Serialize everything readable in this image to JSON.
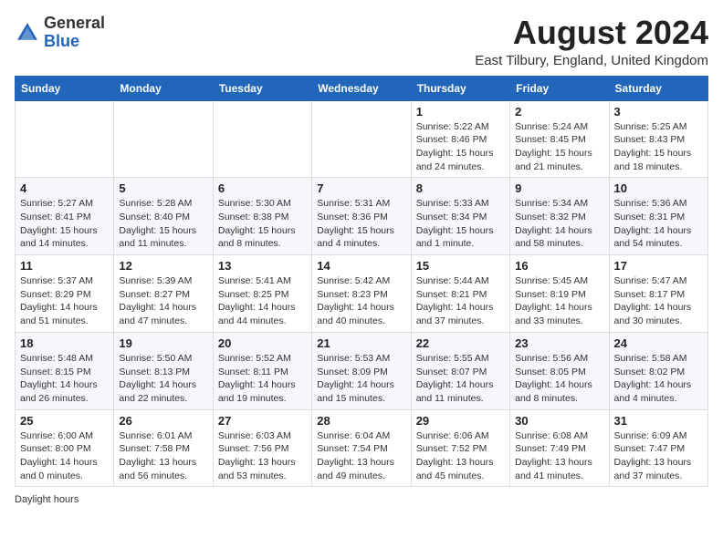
{
  "header": {
    "logo": {
      "line1": "General",
      "line2": "Blue"
    },
    "month_title": "August 2024",
    "location": "East Tilbury, England, United Kingdom"
  },
  "days_of_week": [
    "Sunday",
    "Monday",
    "Tuesday",
    "Wednesday",
    "Thursday",
    "Friday",
    "Saturday"
  ],
  "weeks": [
    [
      {
        "day": "",
        "info": ""
      },
      {
        "day": "",
        "info": ""
      },
      {
        "day": "",
        "info": ""
      },
      {
        "day": "",
        "info": ""
      },
      {
        "day": "1",
        "info": "Sunrise: 5:22 AM\nSunset: 8:46 PM\nDaylight: 15 hours\nand 24 minutes."
      },
      {
        "day": "2",
        "info": "Sunrise: 5:24 AM\nSunset: 8:45 PM\nDaylight: 15 hours\nand 21 minutes."
      },
      {
        "day": "3",
        "info": "Sunrise: 5:25 AM\nSunset: 8:43 PM\nDaylight: 15 hours\nand 18 minutes."
      }
    ],
    [
      {
        "day": "4",
        "info": "Sunrise: 5:27 AM\nSunset: 8:41 PM\nDaylight: 15 hours\nand 14 minutes."
      },
      {
        "day": "5",
        "info": "Sunrise: 5:28 AM\nSunset: 8:40 PM\nDaylight: 15 hours\nand 11 minutes."
      },
      {
        "day": "6",
        "info": "Sunrise: 5:30 AM\nSunset: 8:38 PM\nDaylight: 15 hours\nand 8 minutes."
      },
      {
        "day": "7",
        "info": "Sunrise: 5:31 AM\nSunset: 8:36 PM\nDaylight: 15 hours\nand 4 minutes."
      },
      {
        "day": "8",
        "info": "Sunrise: 5:33 AM\nSunset: 8:34 PM\nDaylight: 15 hours\nand 1 minute."
      },
      {
        "day": "9",
        "info": "Sunrise: 5:34 AM\nSunset: 8:32 PM\nDaylight: 14 hours\nand 58 minutes."
      },
      {
        "day": "10",
        "info": "Sunrise: 5:36 AM\nSunset: 8:31 PM\nDaylight: 14 hours\nand 54 minutes."
      }
    ],
    [
      {
        "day": "11",
        "info": "Sunrise: 5:37 AM\nSunset: 8:29 PM\nDaylight: 14 hours\nand 51 minutes."
      },
      {
        "day": "12",
        "info": "Sunrise: 5:39 AM\nSunset: 8:27 PM\nDaylight: 14 hours\nand 47 minutes."
      },
      {
        "day": "13",
        "info": "Sunrise: 5:41 AM\nSunset: 8:25 PM\nDaylight: 14 hours\nand 44 minutes."
      },
      {
        "day": "14",
        "info": "Sunrise: 5:42 AM\nSunset: 8:23 PM\nDaylight: 14 hours\nand 40 minutes."
      },
      {
        "day": "15",
        "info": "Sunrise: 5:44 AM\nSunset: 8:21 PM\nDaylight: 14 hours\nand 37 minutes."
      },
      {
        "day": "16",
        "info": "Sunrise: 5:45 AM\nSunset: 8:19 PM\nDaylight: 14 hours\nand 33 minutes."
      },
      {
        "day": "17",
        "info": "Sunrise: 5:47 AM\nSunset: 8:17 PM\nDaylight: 14 hours\nand 30 minutes."
      }
    ],
    [
      {
        "day": "18",
        "info": "Sunrise: 5:48 AM\nSunset: 8:15 PM\nDaylight: 14 hours\nand 26 minutes."
      },
      {
        "day": "19",
        "info": "Sunrise: 5:50 AM\nSunset: 8:13 PM\nDaylight: 14 hours\nand 22 minutes."
      },
      {
        "day": "20",
        "info": "Sunrise: 5:52 AM\nSunset: 8:11 PM\nDaylight: 14 hours\nand 19 minutes."
      },
      {
        "day": "21",
        "info": "Sunrise: 5:53 AM\nSunset: 8:09 PM\nDaylight: 14 hours\nand 15 minutes."
      },
      {
        "day": "22",
        "info": "Sunrise: 5:55 AM\nSunset: 8:07 PM\nDaylight: 14 hours\nand 11 minutes."
      },
      {
        "day": "23",
        "info": "Sunrise: 5:56 AM\nSunset: 8:05 PM\nDaylight: 14 hours\nand 8 minutes."
      },
      {
        "day": "24",
        "info": "Sunrise: 5:58 AM\nSunset: 8:02 PM\nDaylight: 14 hours\nand 4 minutes."
      }
    ],
    [
      {
        "day": "25",
        "info": "Sunrise: 6:00 AM\nSunset: 8:00 PM\nDaylight: 14 hours\nand 0 minutes."
      },
      {
        "day": "26",
        "info": "Sunrise: 6:01 AM\nSunset: 7:58 PM\nDaylight: 13 hours\nand 56 minutes."
      },
      {
        "day": "27",
        "info": "Sunrise: 6:03 AM\nSunset: 7:56 PM\nDaylight: 13 hours\nand 53 minutes."
      },
      {
        "day": "28",
        "info": "Sunrise: 6:04 AM\nSunset: 7:54 PM\nDaylight: 13 hours\nand 49 minutes."
      },
      {
        "day": "29",
        "info": "Sunrise: 6:06 AM\nSunset: 7:52 PM\nDaylight: 13 hours\nand 45 minutes."
      },
      {
        "day": "30",
        "info": "Sunrise: 6:08 AM\nSunset: 7:49 PM\nDaylight: 13 hours\nand 41 minutes."
      },
      {
        "day": "31",
        "info": "Sunrise: 6:09 AM\nSunset: 7:47 PM\nDaylight: 13 hours\nand 37 minutes."
      }
    ]
  ],
  "footer": {
    "text": "Daylight hours"
  }
}
